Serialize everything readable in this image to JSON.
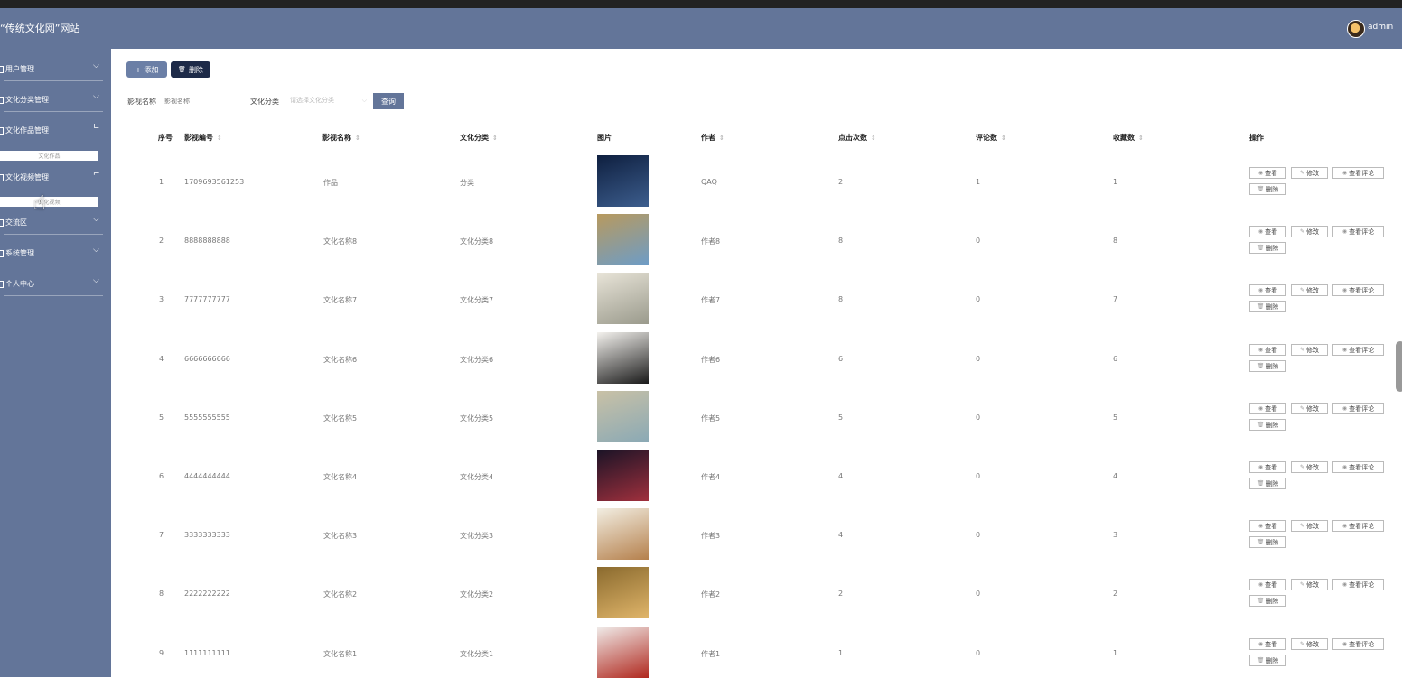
{
  "header": {
    "site_title": "“传统文化网”网站",
    "user": "admin"
  },
  "sidebar": {
    "items": [
      {
        "label": "用户管理",
        "chev": "⌵"
      },
      {
        "label": "文化分类管理",
        "chev": "⌵"
      },
      {
        "label": "文化作品管理",
        "chev": "∟"
      },
      {
        "label": "文化视频管理",
        "chev": "⌐"
      },
      {
        "label": "交流区",
        "chev": "⌵"
      },
      {
        "label": "系统管理",
        "chev": "⌵"
      },
      {
        "label": "个人中心",
        "chev": "⌵"
      }
    ],
    "sub_works": "文化作品",
    "sub_video": "文化视频"
  },
  "toolbar": {
    "add": "添加",
    "delete": "删除",
    "add_icon": "+",
    "delete_icon": "🗑"
  },
  "filters": {
    "name_label": "影视名称",
    "name_placeholder": "影视名称",
    "category_label": "文化分类",
    "category_placeholder": "请选择文化分类",
    "query": "查询"
  },
  "table": {
    "headers": [
      "序号",
      "影视编号",
      "影视名称",
      "文化分类",
      "图片",
      "作者",
      "点击次数",
      "评论数",
      "收藏数",
      "操作"
    ],
    "sort_icon": "⇕",
    "rows": [
      {
        "idx": "1",
        "code": "1709693561253",
        "name": "作品",
        "cat": "分类",
        "author": "QAQ",
        "clicks": "2",
        "comments": "1",
        "favs": "1"
      },
      {
        "idx": "2",
        "code": "8888888888",
        "name": "文化名称8",
        "cat": "文化分类8",
        "author": "作者8",
        "clicks": "8",
        "comments": "0",
        "favs": "8"
      },
      {
        "idx": "3",
        "code": "7777777777",
        "name": "文化名称7",
        "cat": "文化分类7",
        "author": "作者7",
        "clicks": "8",
        "comments": "0",
        "favs": "7"
      },
      {
        "idx": "4",
        "code": "6666666666",
        "name": "文化名称6",
        "cat": "文化分类6",
        "author": "作者6",
        "clicks": "6",
        "comments": "0",
        "favs": "6"
      },
      {
        "idx": "5",
        "code": "5555555555",
        "name": "文化名称5",
        "cat": "文化分类5",
        "author": "作者5",
        "clicks": "5",
        "comments": "0",
        "favs": "5"
      },
      {
        "idx": "6",
        "code": "4444444444",
        "name": "文化名称4",
        "cat": "文化分类4",
        "author": "作者4",
        "clicks": "4",
        "comments": "0",
        "favs": "4"
      },
      {
        "idx": "7",
        "code": "3333333333",
        "name": "文化名称3",
        "cat": "文化分类3",
        "author": "作者3",
        "clicks": "4",
        "comments": "0",
        "favs": "3"
      },
      {
        "idx": "8",
        "code": "2222222222",
        "name": "文化名称2",
        "cat": "文化分类2",
        "author": "作者2",
        "clicks": "2",
        "comments": "0",
        "favs": "2"
      },
      {
        "idx": "9",
        "code": "1111111111",
        "name": "文化名称1",
        "cat": "文化分类1",
        "author": "作者1",
        "clicks": "1",
        "comments": "0",
        "favs": "1"
      }
    ],
    "actions": {
      "view": "查看",
      "edit": "修改",
      "comments": "查看评论",
      "delete": "删除"
    },
    "action_icons": {
      "view": "◉",
      "edit": "✎",
      "comments": "◉",
      "delete": "🗑"
    },
    "thumb_colors": [
      [
        "#0e1f3f",
        "#3d5e8e"
      ],
      [
        "#b89a5e",
        "#6d9cc7"
      ],
      [
        "#e8e4d8",
        "#9a9a8c"
      ],
      [
        "#f4f2ee",
        "#1a1a1a"
      ],
      [
        "#c9c1a6",
        "#8aa9b5"
      ],
      [
        "#1a1326",
        "#a0303d"
      ],
      [
        "#f2eee2",
        "#b5804c"
      ],
      [
        "#8a6a2e",
        "#e0b56a"
      ],
      [
        "#f0ecea",
        "#b0281e"
      ]
    ]
  }
}
